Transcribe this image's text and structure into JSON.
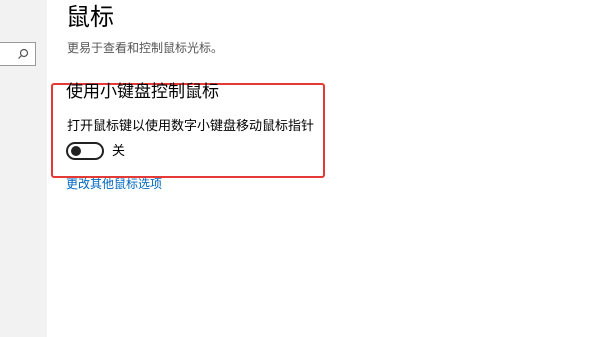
{
  "sidebar": {
    "search": {
      "value": "",
      "icon": "search-icon"
    }
  },
  "page": {
    "title": "鼠标",
    "subtitle": "更易于查看和控制鼠标光标。"
  },
  "numpad_section": {
    "heading": "使用小键盘控制鼠标",
    "setting_label": "打开鼠标键以使用数字小键盘移动鼠标指针",
    "toggle_state_label": "关",
    "toggle_on": false,
    "highlight_color": "#e53935"
  },
  "links": {
    "other_mouse_options": "更改其他鼠标选项"
  }
}
